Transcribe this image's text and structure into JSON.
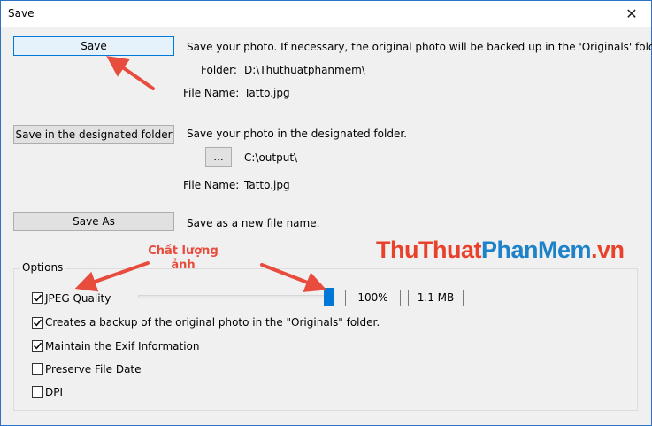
{
  "window": {
    "title": "Save",
    "close_glyph": "✕"
  },
  "save": {
    "button_label": "Save",
    "description": "Save your photo. If necessary, the original photo will be backed up in the 'Originals' folder.",
    "folder_label": "Folder:",
    "folder_value": "D:\\Thuthuatphanmem\\",
    "file_name_label": "File Name:",
    "file_name_value": "Tatto.jpg"
  },
  "designated": {
    "button_label": "Save in the designated folder",
    "description": "Save your photo in the designated folder.",
    "browse_label": "...",
    "folder_value": "C:\\output\\",
    "file_name_label": "File Name:",
    "file_name_value": "Tatto.jpg"
  },
  "save_as": {
    "button_label": "Save As",
    "description": "Save as a new file name."
  },
  "options": {
    "group_label": "Options",
    "jpeg_quality": {
      "label": "JPEG Quality",
      "checked": true,
      "percent_text": "100%",
      "size_text": "1.1 MB",
      "slider_value": 1.0
    },
    "backup": {
      "label": "Creates a backup of the original photo in the \"Originals\" folder.",
      "checked": true
    },
    "exif": {
      "label": "Maintain the Exif Information",
      "checked": true
    },
    "preserve_date": {
      "label": "Preserve File Date",
      "checked": false
    },
    "dpi": {
      "label": "DPI",
      "checked": false
    }
  },
  "annotations": {
    "quality_note_line1": "Chất lượng",
    "quality_note_line2": "ảnh",
    "color": "#e84c3d"
  },
  "watermark": {
    "part1": "ThuThuat",
    "part2": "PhanMem",
    "part3": ".vn"
  }
}
